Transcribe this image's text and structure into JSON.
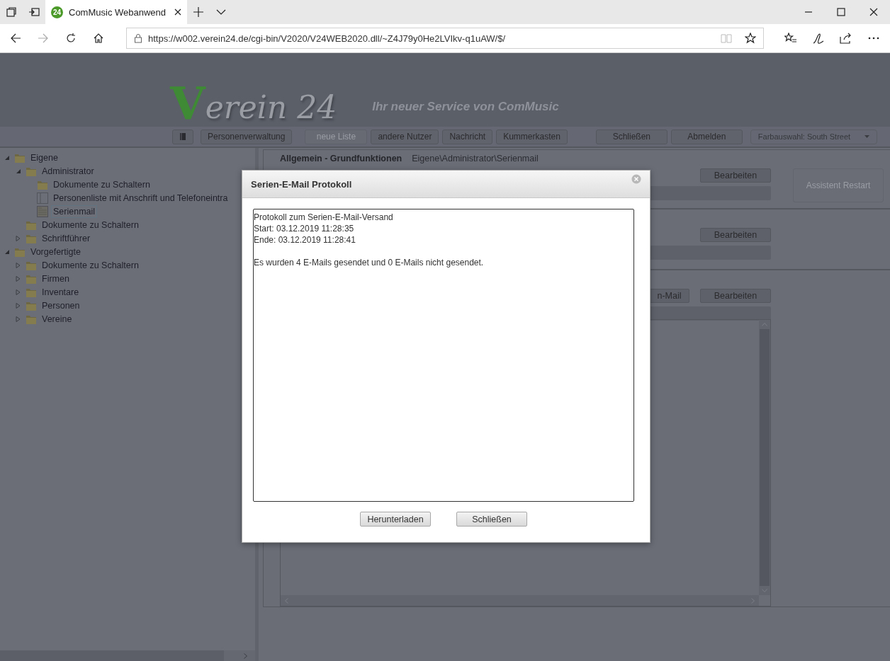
{
  "browser": {
    "tab": {
      "favicon": "24",
      "title": "ComMusic Webanwend"
    },
    "url": "https://w002.verein24.de/cgi-bin/V2020/V24WEB2020.dll/~Z4J79y0He2LVIkv-q1uAW/$/"
  },
  "logo": {
    "initial": "V",
    "rest": "erein 24",
    "tagline": "Ihr neuer Service von ComMusic"
  },
  "toolbar": [
    {
      "kind": "icon"
    },
    {
      "kind": "button",
      "label": "Personenverwaltung",
      "disabled": false
    },
    {
      "kind": "button",
      "label": "neue Liste",
      "disabled": true
    },
    {
      "kind": "button",
      "label": "andere Nutzer",
      "disabled": false
    },
    {
      "kind": "button",
      "label": "Nachricht",
      "disabled": false
    },
    {
      "kind": "button",
      "label": "Kummerkasten",
      "disabled": false
    },
    {
      "kind": "gap"
    },
    {
      "kind": "button",
      "label": "Schließen",
      "disabled": false
    },
    {
      "kind": "button",
      "label": "Abmelden",
      "disabled": false
    },
    {
      "kind": "dropdown",
      "label": "Farbauswahl: South Street"
    }
  ],
  "tree": [
    {
      "label": "Eigene",
      "kind": "folder",
      "expanded": true,
      "selected": false,
      "children": [
        {
          "label": "Administrator",
          "kind": "folder",
          "expanded": true,
          "selected": false,
          "children": [
            {
              "label": "Dokumente zu Schaltern",
              "kind": "folder",
              "selected": false
            },
            {
              "label": "Personenliste mit Anschrift und Telefoneintra",
              "kind": "list",
              "selected": false
            },
            {
              "label": "Serienmail",
              "kind": "mail",
              "selected": true
            }
          ]
        },
        {
          "label": "Dokumente zu Schaltern",
          "kind": "folder",
          "selected": false
        },
        {
          "label": "Schriftführer",
          "kind": "folder",
          "expanded": false,
          "selected": false
        }
      ]
    },
    {
      "label": "Vorgefertigte",
      "kind": "folder",
      "expanded": true,
      "selected": false,
      "children": [
        {
          "label": "Dokumente zu Schaltern",
          "kind": "folder",
          "expanded": false,
          "selected": false
        },
        {
          "label": "Firmen",
          "kind": "folder",
          "expanded": false,
          "selected": false
        },
        {
          "label": "Inventare",
          "kind": "folder",
          "expanded": false,
          "selected": false
        },
        {
          "label": "Personen",
          "kind": "folder",
          "expanded": false,
          "selected": false
        },
        {
          "label": "Vereine",
          "kind": "folder",
          "expanded": false,
          "selected": false
        }
      ]
    }
  ],
  "panel": {
    "title": "Allgemein - Grundfunktionen",
    "path": "Eigene\\Administrator\\Serienmail",
    "sections": [
      {
        "buttons": [
          "Bearbeiten"
        ]
      },
      {
        "buttons": [
          "Bearbeiten"
        ]
      },
      {
        "buttons": [
          "n-Mail",
          "Bearbeiten"
        ]
      }
    ],
    "side_button": {
      "label": "Assistent Restart",
      "disabled": true
    }
  },
  "dialog": {
    "title": "Serien-E-Mail Protokoll",
    "log": [
      "Protokoll zum Serien-E-Mail-Versand",
      "Start: 03.12.2019 11:28:35",
      "Ende: 03.12.2019 11:28:41"
    ],
    "summary": "Es wurden 4 E-Mails gesendet und 0 E-Mails nicht gesendet.",
    "buttons": [
      "Herunterladen",
      "Schließen"
    ]
  }
}
